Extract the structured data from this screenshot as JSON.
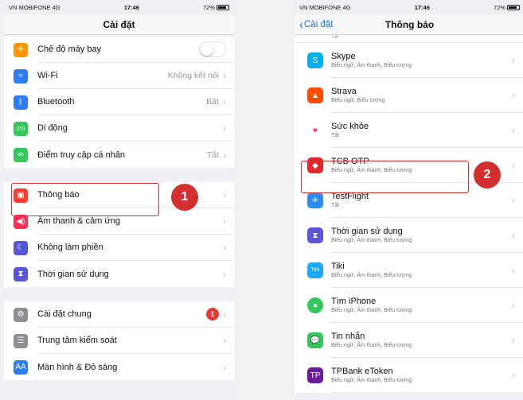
{
  "left": {
    "status": {
      "carrier": "VN MOBIFONE  4G",
      "time": "17:46",
      "battery": "72%"
    },
    "title": "Cài đặt",
    "group1": [
      {
        "label": "Chế độ máy bay",
        "value": "",
        "icon": "airplane-icon",
        "color": "#ff9500",
        "glyph": "✈"
      },
      {
        "label": "Wi-Fi",
        "value": "Không kết nối",
        "icon": "wifi-icon",
        "color": "#2f7cf6",
        "glyph": "≈"
      },
      {
        "label": "Bluetooth",
        "value": "Bật",
        "icon": "bluetooth-icon",
        "color": "#2f7cf6",
        "glyph": "ᛒ"
      },
      {
        "label": "Di động",
        "value": "",
        "icon": "cellular-icon",
        "color": "#34c759",
        "glyph": "((•))"
      },
      {
        "label": "Điểm truy cập cá nhân",
        "value": "Tắt",
        "icon": "hotspot-icon",
        "color": "#34c759",
        "glyph": "∞"
      }
    ],
    "group2": [
      {
        "label": "Thông báo",
        "value": "",
        "icon": "notifications-icon",
        "color": "#ff3b30",
        "glyph": "▣"
      },
      {
        "label": "Âm thanh & cảm ứng",
        "value": "",
        "icon": "sounds-icon",
        "color": "#ff2d55",
        "glyph": "◀)"
      },
      {
        "label": "Không làm phiền",
        "value": "",
        "icon": "do-not-disturb-icon",
        "color": "#5856d6",
        "glyph": "☾"
      },
      {
        "label": "Thời gian sử dụng",
        "value": "",
        "icon": "screen-time-icon",
        "color": "#5856d6",
        "glyph": "⧗"
      }
    ],
    "group3": [
      {
        "label": "Cài đặt chung",
        "value": "",
        "icon": "general-gear-icon",
        "color": "#8e8e93",
        "glyph": "⚙",
        "badge": "1"
      },
      {
        "label": "Trung tâm kiểm soát",
        "value": "",
        "icon": "control-center-icon",
        "color": "#8e8e93",
        "glyph": "☰"
      },
      {
        "label": "Màn hình & Độ sáng",
        "value": "",
        "icon": "display-brightness-icon",
        "color": "#2f7cf6",
        "glyph": "AA"
      }
    ],
    "step": "1"
  },
  "right": {
    "status": {
      "carrier": "VN MOBIFONE  4G",
      "time": "17:46",
      "battery": "72%"
    },
    "back": "Cài đặt",
    "title": "Thông báo",
    "cut_text": "Tắt",
    "apps": [
      {
        "name": "Skype",
        "sub": "Biểu ngữ, Âm thanh, Biểu tượng",
        "icon": "skype-icon",
        "color": "#00aff0",
        "glyph": "S"
      },
      {
        "name": "Strava",
        "sub": "Biểu ngữ, Biểu tượng",
        "icon": "strava-icon",
        "color": "#fc4c02",
        "glyph": "▲"
      },
      {
        "name": "Sức khỏe",
        "sub": "Tắt",
        "icon": "health-heart-icon",
        "color": "#ffffff",
        "glyph": "♥"
      },
      {
        "name": "TCB OTP",
        "sub": "Biểu ngữ, Âm thanh, Biểu tượng",
        "icon": "tcb-otp-icon",
        "color": "#e3262f",
        "glyph": "◆"
      },
      {
        "name": "TestFlight",
        "sub": "Tắt",
        "icon": "testflight-icon",
        "color": "#2d8cf0",
        "glyph": "✈"
      },
      {
        "name": "Thời gian sử dụng",
        "sub": "Biểu ngữ, Âm thanh, Biểu tượng",
        "icon": "screen-time-icon",
        "color": "#5856d6",
        "glyph": "⧗"
      },
      {
        "name": "Tiki",
        "sub": "Biểu ngữ, Âm thanh, Biểu tượng",
        "icon": "tiki-icon",
        "color": "#1ba8ff",
        "glyph": "TIKI"
      },
      {
        "name": "Tìm iPhone",
        "sub": "Biểu ngữ, Âm thanh, Biểu tượng",
        "icon": "find-iphone-icon",
        "color": "#34c759",
        "glyph": "●"
      },
      {
        "name": "Tin nhắn",
        "sub": "Biểu ngữ, Âm thanh, Biểu tượng",
        "icon": "messages-icon",
        "color": "#34c759",
        "glyph": "💬"
      },
      {
        "name": "TPBank eToken",
        "sub": "Biểu ngữ, Âm thanh, Biểu tượng",
        "icon": "tpbank-etoken-icon",
        "color": "#6a1b9a",
        "glyph": "TP"
      }
    ],
    "step": "2"
  }
}
